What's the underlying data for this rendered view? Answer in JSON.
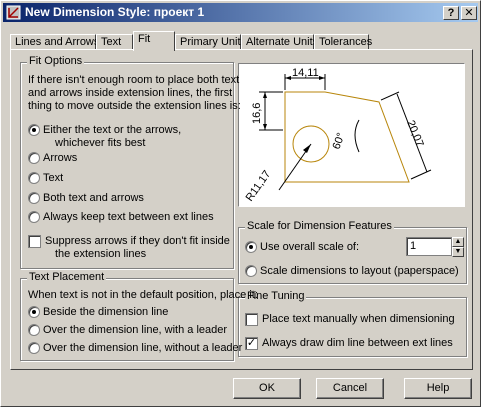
{
  "window": {
    "title": "New Dimension Style: проект 1",
    "help_button": "?",
    "close_button": "✕"
  },
  "tabs": [
    {
      "label": "Lines and Arrows"
    },
    {
      "label": "Text"
    },
    {
      "label": "Fit"
    },
    {
      "label": "Primary Units"
    },
    {
      "label": "Alternate Units"
    },
    {
      "label": "Tolerances"
    }
  ],
  "fit_options": {
    "legend": "Fit Options",
    "description": [
      "If there isn't enough room to place both text",
      "and arrows inside extension lines, the first",
      "thing to move outside the extension lines is:"
    ],
    "options": [
      {
        "line1": "Either the text or the arrows,",
        "line2": "whichever fits best",
        "selected": true
      },
      {
        "line1": "Arrows",
        "selected": false
      },
      {
        "line1": "Text",
        "selected": false
      },
      {
        "line1": "Both text and arrows",
        "selected": false
      },
      {
        "line1": "Always keep text between ext lines",
        "selected": false
      }
    ],
    "suppress": {
      "line1": "Suppress arrows if they don't fit inside",
      "line2": "the extension lines",
      "checked": false
    }
  },
  "text_placement": {
    "legend": "Text Placement",
    "description": "When text is not in the default position, place it:",
    "options": [
      {
        "label": "Beside the dimension line",
        "selected": true
      },
      {
        "label": "Over the dimension line, with a leader",
        "selected": false
      },
      {
        "label": "Over the dimension line, without a leader",
        "selected": false
      }
    ]
  },
  "preview": {
    "labels": {
      "top": "14,11",
      "left": "16,6",
      "right": "20,07",
      "angle": "60°",
      "radius": "R11,17"
    },
    "line_color": "#b8860b"
  },
  "scale": {
    "legend": "Scale for Dimension Features",
    "overall_label": "Use overall scale of:",
    "overall_selected": true,
    "overall_value": "1",
    "layout_label": "Scale dimensions to layout (paperspace)",
    "layout_selected": false
  },
  "fine_tuning": {
    "legend": "Fine Tuning",
    "place_manually": {
      "label": "Place text manually when dimensioning",
      "checked": false
    },
    "always_draw": {
      "label": "Always draw dim line between ext lines",
      "checked": true
    }
  },
  "buttons": {
    "ok": "OK",
    "cancel": "Cancel",
    "help": "Help"
  }
}
